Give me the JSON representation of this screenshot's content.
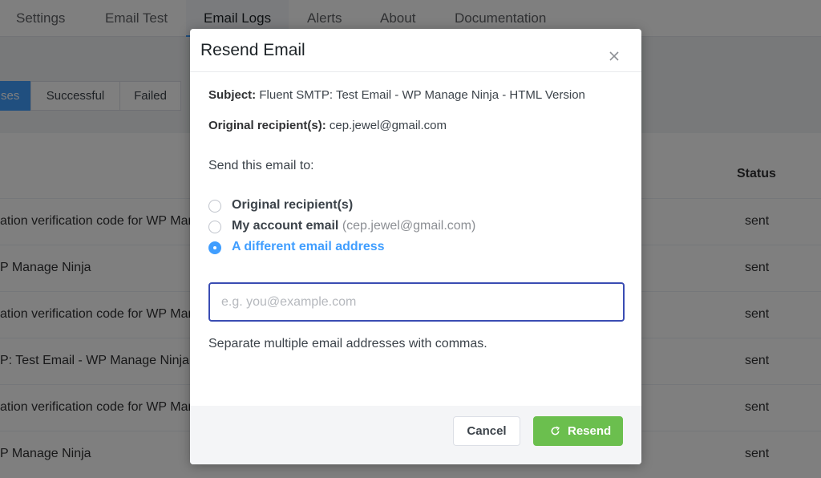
{
  "nav": {
    "tabs": [
      {
        "label": "Settings"
      },
      {
        "label": "Email Test"
      },
      {
        "label": "Email Logs"
      },
      {
        "label": "Alerts"
      },
      {
        "label": "About"
      },
      {
        "label": "Documentation"
      }
    ],
    "active": "Email Logs"
  },
  "filters": {
    "all_partial": "ses",
    "successful": "Successful",
    "failed": "Failed"
  },
  "table": {
    "status_header": "Status",
    "rows": [
      {
        "subject": "ation verification code for WP Manage Ninja",
        "status": "sent"
      },
      {
        "subject": "P Manage Ninja",
        "status": "sent"
      },
      {
        "subject": "ation verification code for WP Manage Ninja",
        "status": "sent"
      },
      {
        "subject": "P: Test Email - WP Manage Ninja",
        "status": "sent"
      },
      {
        "subject": "ation verification code for WP Manage Ninja",
        "status": "sent"
      },
      {
        "subject": "P Manage Ninja",
        "status": "sent"
      }
    ]
  },
  "modal": {
    "title": "Resend Email",
    "subject_label": "Subject:",
    "subject_value": "Fluent SMTP: Test Email - WP Manage Ninja - HTML Version",
    "recipient_label": "Original recipient(s):",
    "recipient_value": "cep.jewel@gmail.com",
    "send_to_label": "Send this email to:",
    "options": {
      "original": "Original recipient(s)",
      "account": "My account email",
      "account_hint": "(cep.jewel@gmail.com)",
      "different": "A different email address"
    },
    "selected_option": "A different email address",
    "input": {
      "placeholder": "e.g. you@example.com",
      "value": ""
    },
    "help_text": "Separate multiple email addresses with commas.",
    "cancel_label": "Cancel",
    "resend_label": "Resend"
  },
  "colors": {
    "accent": "#409eff",
    "success": "#6bbf4e",
    "input_focus": "#3a4cb3"
  }
}
